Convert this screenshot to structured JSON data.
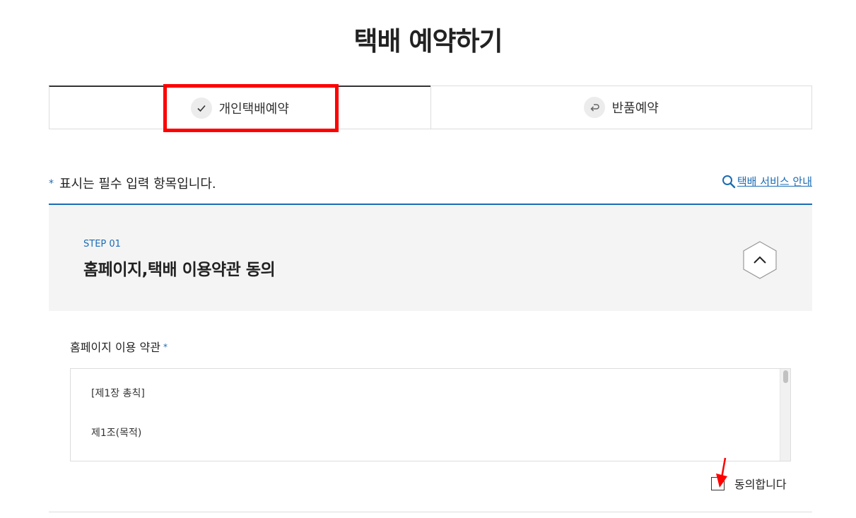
{
  "page": {
    "title": "택배 예약하기"
  },
  "tabs": [
    {
      "label": "개인택배예약",
      "icon": "check-icon",
      "active": true
    },
    {
      "label": "반품예약",
      "icon": "return-arrow-icon",
      "active": false
    }
  ],
  "notice": {
    "star": "*",
    "text": "표시는 필수 입력 항목입니다."
  },
  "service_link": {
    "label": "택배 서비스 안내",
    "icon": "search-icon"
  },
  "step": {
    "label": "STEP 01",
    "title": "홈페이지,택배 이용약관 동의",
    "toggle_icon": "chevron-up-icon"
  },
  "terms": {
    "label": "홈페이지 이용 약관",
    "star": "*",
    "lines": [
      "[제1장 총칙]",
      "제1조(목적)"
    ]
  },
  "agree": {
    "label": "동의합니다",
    "checked": false
  },
  "colors": {
    "accent": "#1a6cb5",
    "annotation": "#ff0000"
  }
}
